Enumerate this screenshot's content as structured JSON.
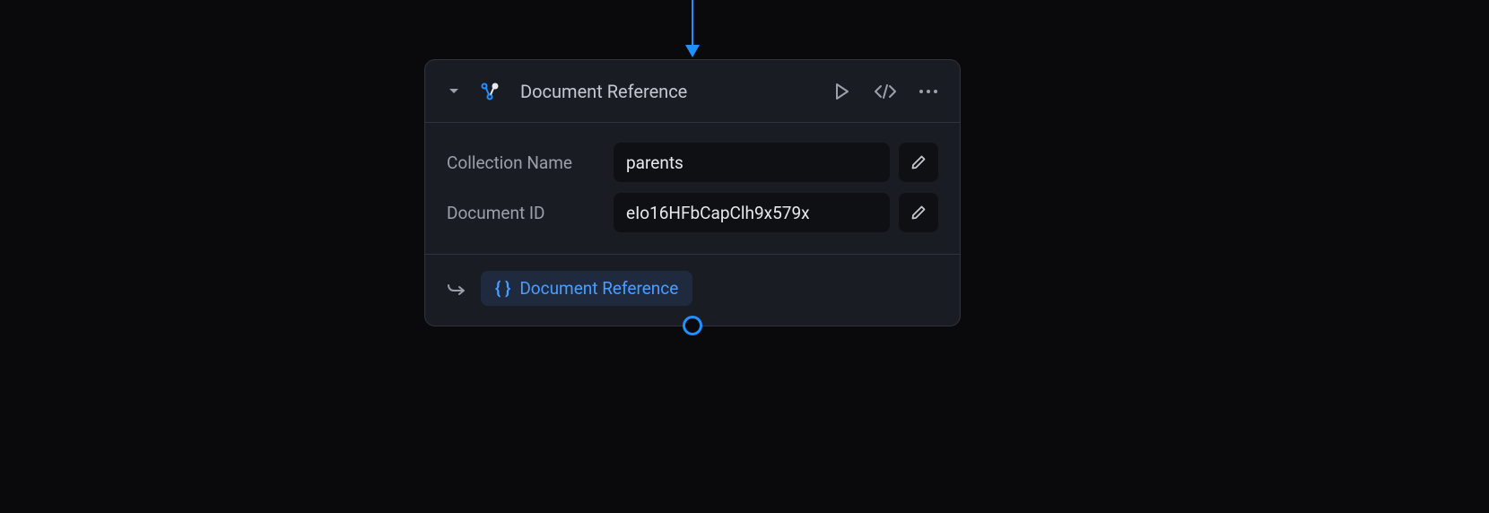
{
  "node": {
    "title": "Document Reference",
    "fields": [
      {
        "label": "Collection Name",
        "value": "parents"
      },
      {
        "label": "Document ID",
        "value": "eIo16HFbCapClh9x579x"
      }
    ],
    "output": {
      "label": "Document Reference"
    }
  },
  "colors": {
    "accent": "#2090ff",
    "panel": "#1a1c23",
    "input": "#0e1014"
  }
}
